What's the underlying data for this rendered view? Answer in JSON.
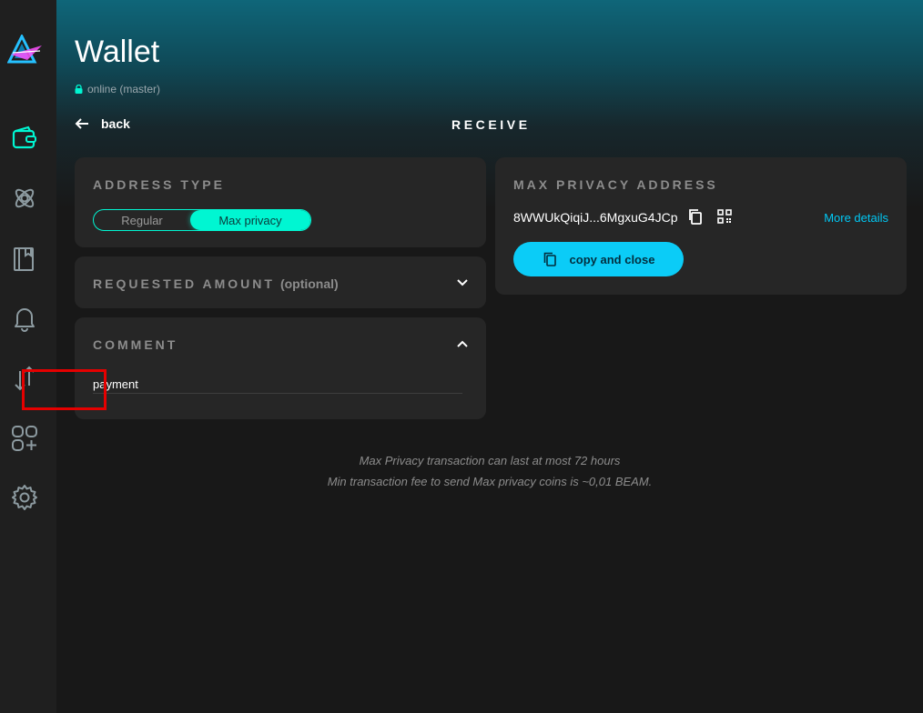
{
  "window": {
    "title": "Wallet",
    "status": "online (master)"
  },
  "nav": {
    "back_label": "back",
    "page_heading": "RECEIVE"
  },
  "sidebar": {
    "items": [
      {
        "icon": "wallet-icon",
        "active": true
      },
      {
        "icon": "atom-icon"
      },
      {
        "icon": "address-book-icon"
      },
      {
        "icon": "bell-icon"
      },
      {
        "icon": "arrows-up-down-icon"
      },
      {
        "icon": "apps-icon"
      },
      {
        "icon": "gear-icon"
      }
    ]
  },
  "address_type": {
    "title": "ADDRESS TYPE",
    "options": [
      "Regular",
      "Max privacy"
    ],
    "selected": "Max privacy"
  },
  "requested_amount": {
    "title": "REQUESTED AMOUNT",
    "optional_label": "(optional)"
  },
  "comment": {
    "title": "COMMENT",
    "value": "payment"
  },
  "max_privacy": {
    "title": "MAX PRIVACY ADDRESS",
    "address": "8WWUkQiqiJ...6MgxuG4JCp",
    "more_details": "More details",
    "copy_button": "copy and close"
  },
  "notes": {
    "line1": "Max Privacy transaction can last at most 72 hours",
    "line2": "Min transaction fee to send Max privacy coins is ~0,01 BEAM."
  },
  "colors": {
    "accent": "#00f6d2",
    "button": "#0bccf7",
    "link": "#00c8f4",
    "highlight": "#e50000"
  }
}
